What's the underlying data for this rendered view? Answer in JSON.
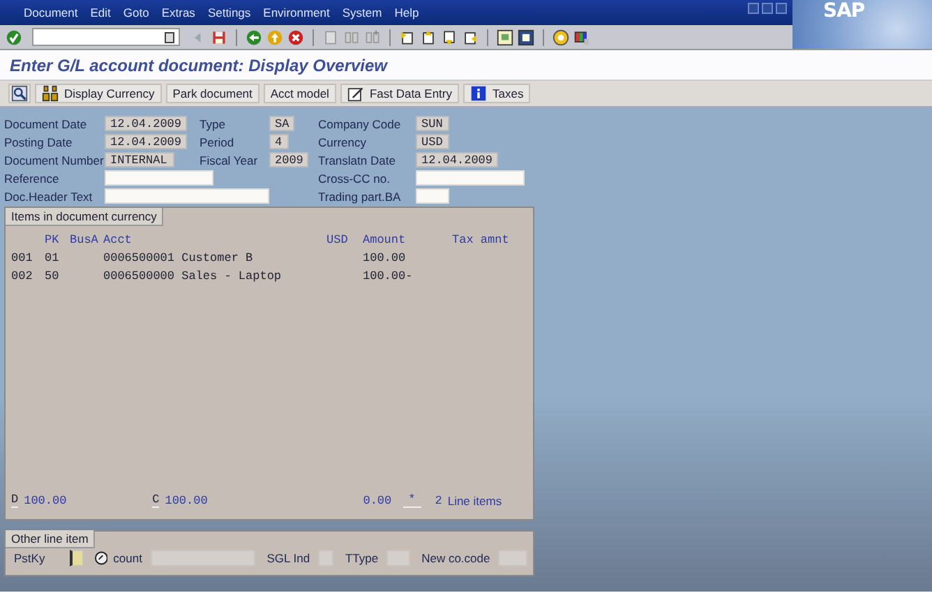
{
  "menu": [
    "Document",
    "Edit",
    "Goto",
    "Extras",
    "Settings",
    "Environment",
    "System",
    "Help"
  ],
  "logo": "SAP",
  "title": "Enter G/L account document: Display Overview",
  "app_toolbar": [
    "Display Currency",
    "Park document",
    "Acct model",
    "Fast Data Entry",
    "Taxes"
  ],
  "header_rows": [
    {
      "left": {
        "label": "Document Date",
        "value": "12.04.2009",
        "editable": false
      },
      "middle": {
        "label": "Type",
        "value": "SA",
        "editable": false
      },
      "right": {
        "label": "Company Code",
        "value": "SUN",
        "editable": false
      }
    },
    {
      "left": {
        "label": "Posting Date",
        "value": "12.04.2009",
        "editable": false
      },
      "middle": {
        "label": "Period",
        "value": "4",
        "editable": false
      },
      "right": {
        "label": "Currency",
        "value": "USD",
        "editable": false
      }
    },
    {
      "left": {
        "label": "Document Number",
        "value": "INTERNAL",
        "editable": false
      },
      "middle": {
        "label": "Fiscal Year",
        "value": "2009",
        "editable": false
      },
      "right": {
        "label": "Translatn Date",
        "value": "12.04.2009",
        "editable": false
      }
    },
    {
      "left": {
        "label": "Reference",
        "editable": true
      },
      "right": {
        "label": "Cross-CC no.",
        "editable": true
      }
    },
    {
      "left": {
        "label": "Doc.Header Text",
        "editable": true
      },
      "right": {
        "label": "Trading part.BA",
        "editable": true
      }
    }
  ],
  "items": {
    "title": "Items in document currency",
    "columns": [
      "PK",
      "BusA",
      "Acct",
      "USD",
      "Amount",
      "Tax amnt"
    ],
    "rows": [
      {
        "line": "001",
        "pk": "01",
        "account": "0006500001 Customer B",
        "amount": "100.00"
      },
      {
        "line": "002",
        "pk": "50",
        "account": "0006500000 Sales - Laptop",
        "amount": "100.00-"
      }
    ],
    "totals": {
      "debit_label": "D",
      "debit": "100.00",
      "credit_label": "C",
      "credit": "100.00",
      "balance": "0.00",
      "marker": "*",
      "count": "2",
      "count_label": "Line items"
    }
  },
  "other_line_item": {
    "title": "Other line item",
    "fields": [
      {
        "label": "PstKy",
        "focused": true
      },
      {
        "label": "count",
        "focused": false
      },
      {
        "label": "SGL Ind",
        "focused": false
      },
      {
        "label": "TType",
        "focused": false
      },
      {
        "label": "New co.code",
        "focused": false
      }
    ]
  }
}
